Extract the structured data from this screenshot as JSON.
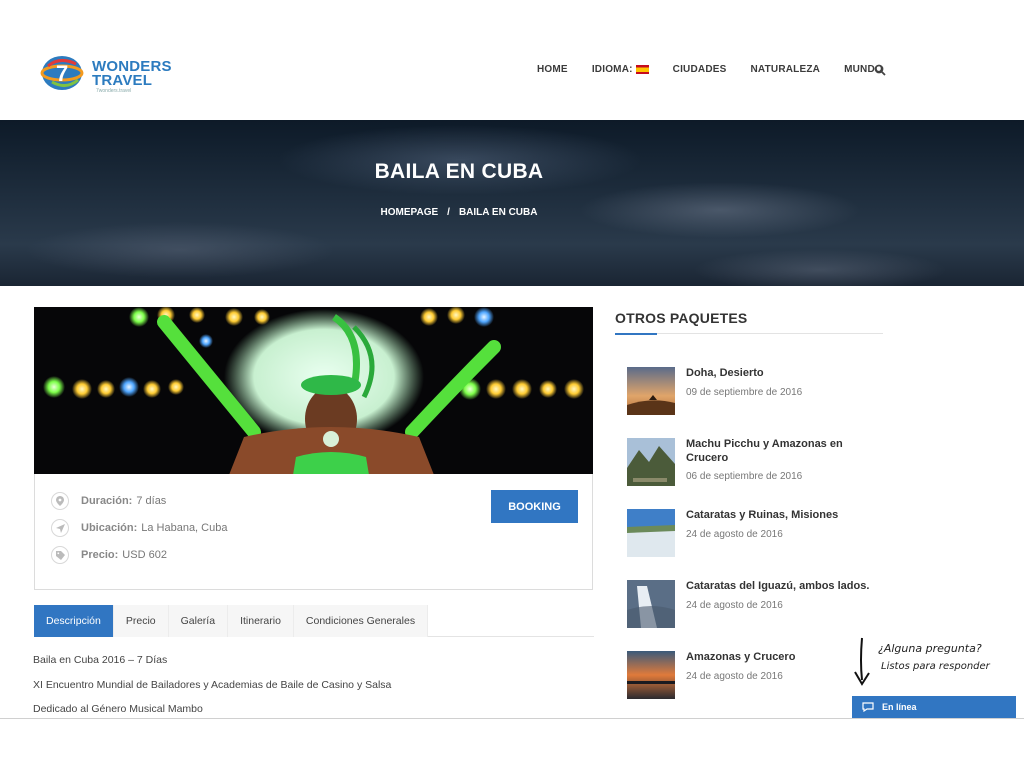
{
  "header": {
    "logo_line1": "WONDERS",
    "logo_line2": "TRAVEL",
    "logo_sub": "7wonders.travel",
    "nav": [
      "HOME",
      "IDIOMA:",
      "CIUDADES",
      "NATURALEZA",
      "MUNDO"
    ]
  },
  "hero": {
    "title": "BAILA EN CUBA",
    "breadcrumb_home": "HOMEPAGE",
    "breadcrumb_sep": "/",
    "breadcrumb_current": "BAILA EN CUBA"
  },
  "tour": {
    "duration_label": "Duración:",
    "duration_value": "7 días",
    "location_label": "Ubicación:",
    "location_value": "La Habana, Cuba",
    "price_label": "Precio:",
    "price_value": "USD 602",
    "booking_label": "BOOKING"
  },
  "tabs": [
    "Descripción",
    "Precio",
    "Galería",
    "Itinerario",
    "Condiciones Generales"
  ],
  "description": [
    "Baila en Cuba 2016 – 7 Días",
    "XI Encuentro Mundial de Bailadores y Academias de Baile de Casino y Salsa",
    "Dedicado al Género Musical Mambo"
  ],
  "sidebar": {
    "title": "OTROS PAQUETES",
    "packages": [
      {
        "title": "Doha, Desierto",
        "date": "09 de septiembre de 2016"
      },
      {
        "title": "Machu Picchu y Amazonas en Crucero",
        "date": "06 de septiembre de 2016"
      },
      {
        "title": "Cataratas y Ruinas, Misiones",
        "date": "24 de agosto de 2016"
      },
      {
        "title": "Cataratas del Iguazú, ambos lados.",
        "date": "24 de agosto de 2016"
      },
      {
        "title": "Amazonas y Crucero",
        "date": "24 de agosto de 2016"
      }
    ]
  },
  "chat": {
    "note_line1": "¿Alguna pregunta?",
    "note_line2": "Listos para responder",
    "status": "En línea"
  },
  "colors": {
    "accent": "#3176c2",
    "hero_dark": "#0d1a28"
  }
}
